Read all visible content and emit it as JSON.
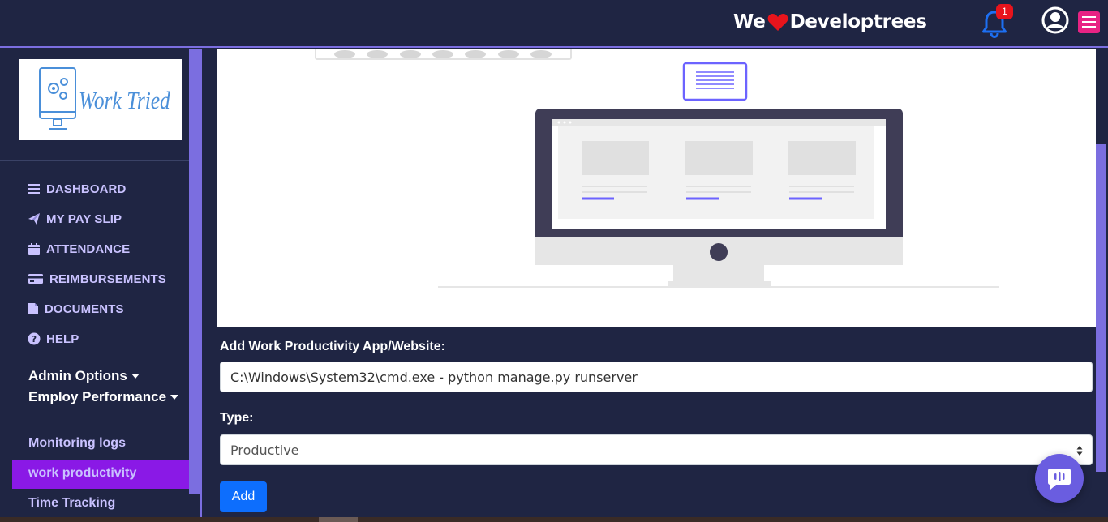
{
  "header": {
    "brand_pre": "We",
    "brand_post": "Developtrees",
    "notification_count": "1",
    "colors": {
      "background": "#1f2543",
      "accent": "#7b6ee0",
      "heart": "#e8141c",
      "menu": "#e82384"
    }
  },
  "sidebar": {
    "logo_text": "Work Tried",
    "items": [
      {
        "label": "DASHBOARD",
        "icon": "bars-icon"
      },
      {
        "label": "MY PAY SLIP",
        "icon": "paper-plane-icon"
      },
      {
        "label": "ATTENDANCE",
        "icon": "calendar-icon"
      },
      {
        "label": "REIMBURSEMENTS",
        "icon": "credit-card-icon"
      },
      {
        "label": "DOCUMENTS",
        "icon": "file-icon"
      },
      {
        "label": "HELP",
        "icon": "question-circle-icon"
      }
    ],
    "admin_options": "Admin Options",
    "employ_performance": "Employ Performance",
    "sub_items": [
      {
        "label": "Monitoring logs"
      },
      {
        "label": "work productivity",
        "active": true
      },
      {
        "label": "Time Tracking"
      }
    ],
    "active_color": "#8a19e6"
  },
  "form": {
    "app_label": "Add Work Productivity App/Website:",
    "app_value": "C:\\Windows\\System32\\cmd.exe - python manage.py runserver",
    "type_label": "Type:",
    "type_selected": "Productive",
    "add_label": "Add",
    "button_color": "#0d6efd"
  }
}
